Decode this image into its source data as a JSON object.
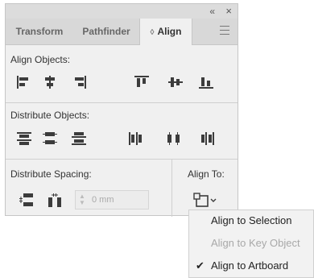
{
  "window": {
    "collapse_glyph": "«",
    "close_glyph": "×"
  },
  "tabs": [
    {
      "label": "Transform"
    },
    {
      "label": "Pathfinder"
    },
    {
      "label": "Align",
      "active": true,
      "marker": "◊"
    }
  ],
  "sections": {
    "align_objects": "Align Objects:",
    "distribute_objects": "Distribute Objects:",
    "distribute_spacing": "Distribute Spacing:",
    "align_to": "Align To:"
  },
  "spacing_field": {
    "value": "0 mm"
  },
  "align_to_menu": {
    "items": [
      {
        "label": "Align to Selection",
        "enabled": true,
        "checked": false
      },
      {
        "label": "Align to Key Object",
        "enabled": false,
        "checked": false
      },
      {
        "label": "Align to Artboard",
        "enabled": true,
        "checked": true
      }
    ],
    "check_glyph": "✔"
  },
  "icons": {
    "align_objects": [
      "horizontal-align-left-icon",
      "horizontal-align-center-icon",
      "horizontal-align-right-icon",
      "vertical-align-top-icon",
      "vertical-align-center-icon",
      "vertical-align-bottom-icon"
    ],
    "distribute_objects": [
      "vertical-distribute-top-icon",
      "vertical-distribute-center-icon",
      "vertical-distribute-bottom-icon",
      "horizontal-distribute-left-icon",
      "horizontal-distribute-center-icon",
      "horizontal-distribute-right-icon"
    ],
    "distribute_spacing": [
      "vertical-distribute-space-icon",
      "horizontal-distribute-space-icon"
    ],
    "align_to": "align-to-artboard-icon"
  },
  "colors": {
    "panel_bg": "#f0f0f0",
    "tab_bg": "#d8d8d8",
    "icon": "#3c3c3c"
  }
}
